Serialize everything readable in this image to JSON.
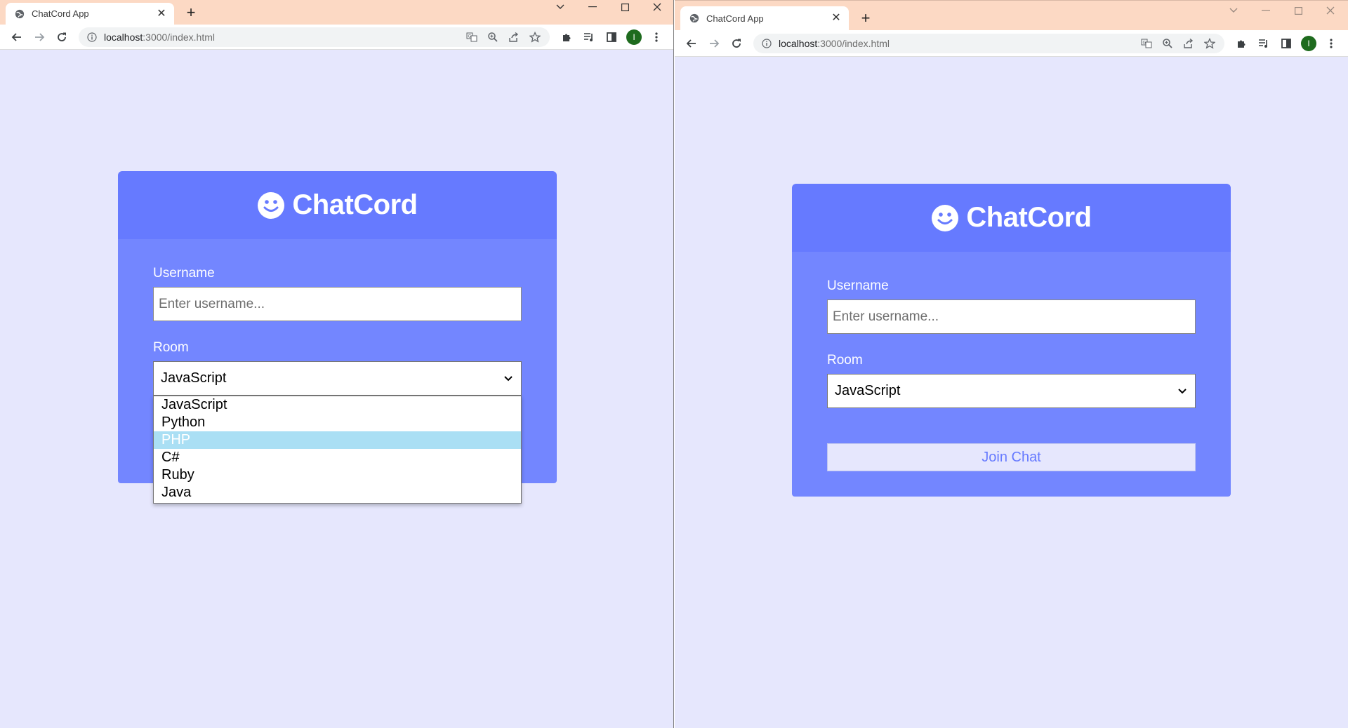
{
  "browser_left": {
    "tab_title": "ChatCord App",
    "new_tab_label": "+",
    "address_host": "localhost",
    "address_path": ":3000/index.html",
    "profile_initial": "I"
  },
  "browser_right": {
    "tab_title": "ChatCord App",
    "new_tab_label": "+",
    "address_host": "localhost",
    "address_path": ":3000/index.html",
    "profile_initial": "I"
  },
  "app": {
    "title": "ChatCord",
    "username_label": "Username",
    "username_placeholder": "Enter username...",
    "username_value": "",
    "room_label": "Room",
    "room_selected": "JavaScript",
    "room_options": [
      "JavaScript",
      "Python",
      "PHP",
      "C#",
      "Ruby",
      "Java"
    ],
    "highlighted_option": "PHP",
    "join_button_label": "Join Chat"
  },
  "colors": {
    "page_bg": "#e6e7fd",
    "header_bg": "#667aff",
    "body_bg": "#7386ff",
    "tabstrip_bg": "#fcd9c4",
    "option_highlight": "#aadff4"
  },
  "icons": {
    "logo": "smile-icon",
    "favicon": "globe-icon",
    "back": "arrow-left-icon",
    "forward": "arrow-right-icon",
    "reload": "reload-icon",
    "site_info": "info-icon",
    "translate": "translate-icon",
    "zoom": "zoom-icon",
    "share": "share-icon",
    "bookmark": "star-icon",
    "extensions": "puzzle-icon",
    "media": "media-queue-icon",
    "side_panel": "side-panel-icon",
    "menu": "more-vert-icon"
  }
}
